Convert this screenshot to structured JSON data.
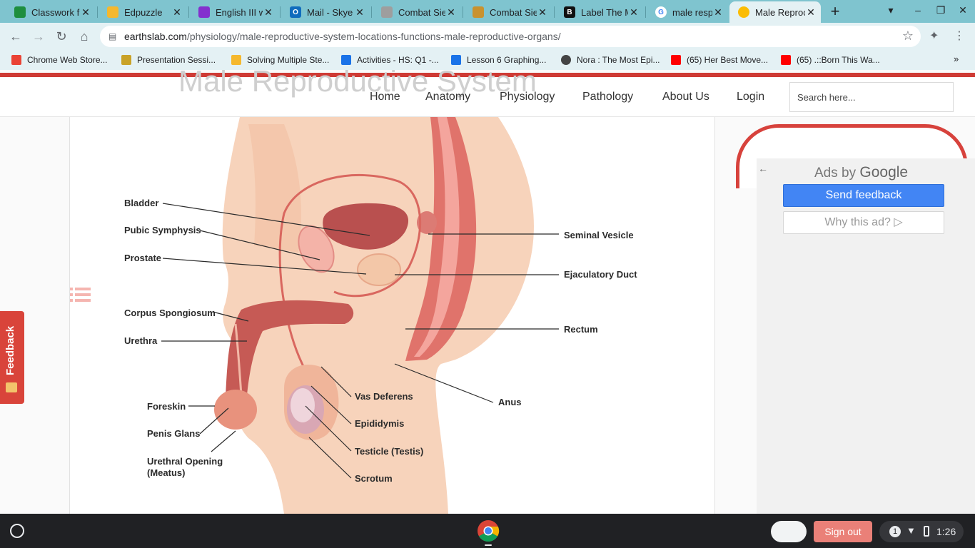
{
  "browser": {
    "tabs": [
      {
        "title": "Classwork f",
        "favicon_color": "#1e8e3e"
      },
      {
        "title": "Edpuzzle",
        "favicon_color": "#f5b82e"
      },
      {
        "title": "English III w",
        "favicon_color": "#8430ce"
      },
      {
        "title": "Mail - Skye I",
        "favicon_color": "#0f6cbd"
      },
      {
        "title": "Combat Sie",
        "favicon_color": "#9e9e9e"
      },
      {
        "title": "Combat Sie",
        "favicon_color": "#c9922e"
      },
      {
        "title": "Label The M",
        "favicon_color": "#111111"
      },
      {
        "title": "male respir",
        "favicon_color": "#4285f4"
      },
      {
        "title": "Male Reproc",
        "favicon_color": "#fbbc04",
        "active": true
      }
    ],
    "new_tab_label": "+",
    "url_domain": "earthslab.com",
    "url_path": "/physiology/male-reproductive-system-locations-functions-male-reproductive-organs/",
    "bookmarks": [
      {
        "label": "Chrome Web Store...",
        "color": "#ea4335"
      },
      {
        "label": "Presentation Sessi...",
        "color": "#c9a227"
      },
      {
        "label": "Solving Multiple Ste...",
        "color": "#f5b82e"
      },
      {
        "label": "Activities - HS: Q1 -...",
        "color": "#1a73e8"
      },
      {
        "label": "Lesson 6 Graphing...",
        "color": "#1a73e8"
      },
      {
        "label": "Nora : The Most Epi...",
        "color": "#444444"
      },
      {
        "label": "(65) Her Best Move...",
        "color": "#ff0000"
      },
      {
        "label": "(65) .::Born This Wa...",
        "color": "#ff0000"
      }
    ]
  },
  "site": {
    "ghost_title": "Male Reproductive System",
    "nav": [
      "Home",
      "Anatomy",
      "Physiology",
      "Pathology",
      "About Us",
      "Login"
    ],
    "search_placeholder": "Search here...",
    "feedback_label": "Feedback"
  },
  "diagram": {
    "labels": {
      "bladder": "Bladder",
      "pubic_symphysis": "Pubic Symphysis",
      "prostate": "Prostate",
      "corpus_spongiosum": "Corpus Spongiosum",
      "urethra": "Urethra",
      "foreskin": "Foreskin",
      "penis_glans": "Penis Glans",
      "urethral_opening_1": "Urethral Opening",
      "urethral_opening_2": "(Meatus)",
      "seminal_vesicle": "Seminal Vesicle",
      "ejaculatory_duct": "Ejaculatory Duct",
      "rectum": "Rectum",
      "anus": "Anus",
      "vas_deferens": "Vas Deferens",
      "epididymis": "Epididymis",
      "testicle": "Testicle (Testis)",
      "scrotum": "Scrotum"
    },
    "colors": {
      "skin": "#f6c9ad",
      "tissue": "#d9675f",
      "dark_tissue": "#b84a4a"
    }
  },
  "ad": {
    "ads_by": "Ads by",
    "google": "Google",
    "send_feedback": "Send feedback",
    "why_this_ad": "Why this ad?"
  },
  "shelf": {
    "sign_out": "Sign out",
    "notification_count": "1",
    "time": "1:26"
  }
}
